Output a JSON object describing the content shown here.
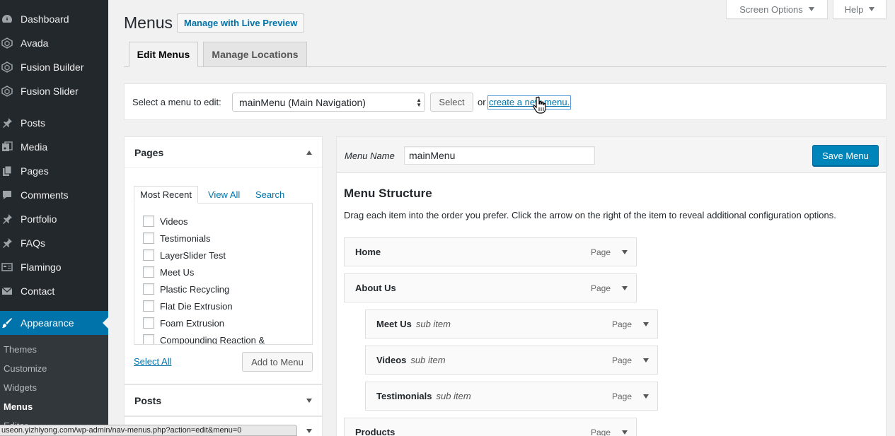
{
  "sidebar": {
    "items": [
      {
        "label": "Dashboard",
        "icon": "dashboard-icon"
      },
      {
        "label": "Avada",
        "icon": "avada-icon"
      },
      {
        "label": "Fusion Builder",
        "icon": "fusion-builder-icon"
      },
      {
        "label": "Fusion Slider",
        "icon": "fusion-slider-icon"
      },
      {
        "label": "Posts",
        "icon": "pin-icon"
      },
      {
        "label": "Media",
        "icon": "media-icon"
      },
      {
        "label": "Pages",
        "icon": "pages-icon"
      },
      {
        "label": "Comments",
        "icon": "comments-icon"
      },
      {
        "label": "Portfolio",
        "icon": "pin-icon"
      },
      {
        "label": "FAQs",
        "icon": "pin-icon"
      },
      {
        "label": "Flamingo",
        "icon": "flamingo-icon"
      },
      {
        "label": "Contact",
        "icon": "mail-icon"
      },
      {
        "label": "Appearance",
        "icon": "brush-icon"
      }
    ],
    "submenu": [
      "Themes",
      "Customize",
      "Widgets",
      "Menus",
      "Editor"
    ]
  },
  "header": {
    "screen_options": "Screen Options",
    "help": "Help",
    "title": "Menus",
    "live_preview": "Manage with Live Preview"
  },
  "tabs": {
    "edit": "Edit Menus",
    "locations": "Manage Locations"
  },
  "manage": {
    "label": "Select a menu to edit:",
    "selected_menu": "mainMenu (Main Navigation)",
    "select_button": "Select",
    "or": "or",
    "create_link": "create a new menu",
    "period": "."
  },
  "pages_box": {
    "title": "Pages",
    "tabs": [
      "Most Recent",
      "View All",
      "Search"
    ],
    "items": [
      "Videos",
      "Testimonials",
      "LayerSlider Test",
      "Meet Us",
      "Plastic Recycling",
      "Flat Die Extrusion",
      "Foam Extrusion",
      "Compounding Reaction &"
    ],
    "select_all": "Select All",
    "add_button": "Add to Menu"
  },
  "posts_box": {
    "title": "Posts"
  },
  "menu_edit": {
    "name_label": "Menu Name",
    "name_value": "mainMenu",
    "save_button": "Save Menu",
    "structure_title": "Menu Structure",
    "structure_desc": "Drag each item into the order you prefer. Click the arrow on the right of the item to reveal additional configuration options.",
    "items": [
      {
        "title": "Home",
        "sub": "",
        "type": "Page"
      },
      {
        "title": "About Us",
        "sub": "",
        "type": "Page"
      },
      {
        "title": "Meet Us",
        "sub": "sub item",
        "type": "Page"
      },
      {
        "title": "Videos",
        "sub": "sub item",
        "type": "Page"
      },
      {
        "title": "Testimonials",
        "sub": "sub item",
        "type": "Page"
      },
      {
        "title": "Products",
        "sub": "",
        "type": "Page"
      }
    ]
  },
  "status_url": "useon.yizhiyong.com/wp-admin/nav-menus.php?action=edit&menu=0",
  "colors": {
    "sidebar": "#23282d",
    "accent": "#0073aa",
    "primary_button": "#0085ba"
  }
}
